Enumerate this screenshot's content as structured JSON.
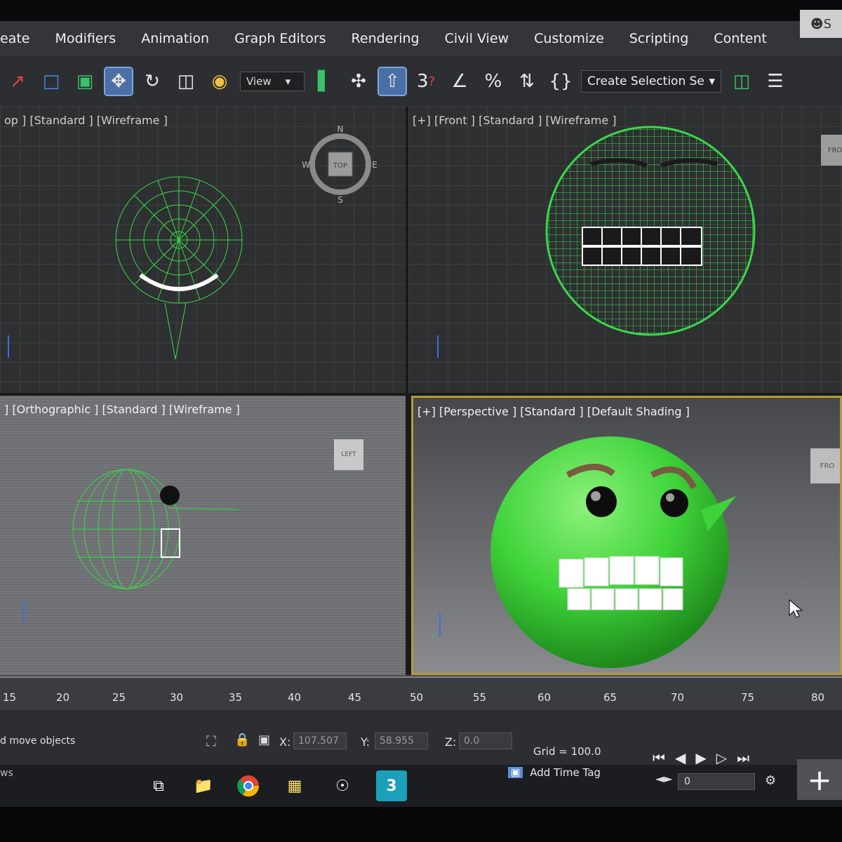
{
  "menu": {
    "items": [
      "eate",
      "Modifiers",
      "Animation",
      "Graph Editors",
      "Rendering",
      "Civil View",
      "Customize",
      "Scripting",
      "Content"
    ],
    "user_label": "S"
  },
  "toolbar": {
    "view_dropdown": "View",
    "snap_3_label": "3",
    "snap_percent_label": "%",
    "selection_set_label": "Create Selection Se",
    "icons": [
      "select-link-icon",
      "select-region-icon",
      "window-crossing-icon",
      "move-icon",
      "rotate-icon",
      "scale-icon",
      "place-icon",
      "mirror-icon",
      "align-icon",
      "snap-icon",
      "angle-snap-icon",
      "percent-snap-icon",
      "spinner-snap-icon",
      "edit-named-selection-icon"
    ]
  },
  "viewports": {
    "top": {
      "label": "op ] [Standard ] [Wireframe ]",
      "viewcube": "TOP",
      "compass": {
        "n": "N",
        "s": "S",
        "e": "E",
        "w": "W"
      }
    },
    "front": {
      "label": "[+] [Front ] [Standard ] [Wireframe ]",
      "viewcube": "FRO"
    },
    "left": {
      "label": "] [Orthographic ] [Standard ] [Wireframe ]",
      "viewcube": "LEFT"
    },
    "perspective": {
      "label": "[+] [Perspective ] [Standard ] [Default Shading ]",
      "viewcube": "FRO"
    }
  },
  "timeline": {
    "ticks": [
      "15",
      "20",
      "25",
      "30",
      "35",
      "40",
      "45",
      "50",
      "55",
      "60",
      "65",
      "70",
      "75",
      "80"
    ]
  },
  "status": {
    "prompt": "d move objects",
    "x_label": "X:",
    "x_value": "107.507",
    "y_label": "Y:",
    "y_value": "58.955",
    "z_label": "Z:",
    "z_value": "0.0",
    "grid": "Grid = 100.0",
    "add_time_tag": "Add Time Tag",
    "frame": "0",
    "windows_text": "ws"
  },
  "taskbar": {
    "app_icons": [
      "task-view-icon",
      "file-explorer-icon",
      "chrome-icon",
      "stickies-icon",
      "media-icon",
      "3dsmax-icon"
    ],
    "max_icon_label": "3"
  },
  "colors": {
    "wireframe_green": "#39d84a",
    "smiley_green": "#3fd33a",
    "active_viewport_border": "#b49a3a"
  }
}
